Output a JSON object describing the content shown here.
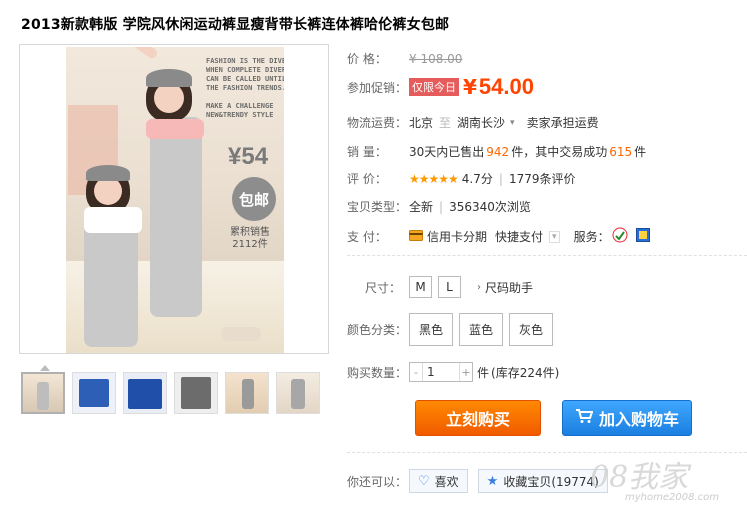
{
  "title": "2013新款韩版 学院风休闲运动裤显瘦背带长裤连体裤哈伦裤女包邮",
  "image_overlay": {
    "text": "FASHION IS THE DIVERSITY\nWHEN COMPLETE DIVERSITY\nCAN BE CALLED UNTIL\nTHE FASHION TRENDS.\n\nMAKE A CHALLENGE\nNEW&TRENDY STYLE",
    "price": "¥54",
    "badge": "包邮",
    "sold": "累积销售\n2112件"
  },
  "price": {
    "label": "价 格：",
    "original": "¥ 108.00"
  },
  "promo": {
    "label": "参加促销：",
    "tag": "仅限今日",
    "currency": "¥",
    "value": "54.00"
  },
  "shipping": {
    "label": "物流运费：",
    "from": "北京",
    "divider": "至",
    "to": "湖南长沙",
    "fee": "卖家承担运费"
  },
  "sales": {
    "label": "销 量：",
    "prefix": "30天内已售出",
    "count": "942",
    "mid": "件，其中交易成功",
    "success": "615",
    "suffix": "件"
  },
  "rating": {
    "label": "评 价：",
    "stars": "★★★★★",
    "score": "4.7分",
    "reviews": "1779条评价"
  },
  "item_type": {
    "label": "宝贝类型：",
    "condition": "全新",
    "views": "356340次浏览"
  },
  "payment": {
    "label": "支 付：",
    "credit": "信用卡分期",
    "fast": "快捷支付",
    "service_label": "服务："
  },
  "size": {
    "label": "尺寸：",
    "options": [
      "M",
      "L"
    ],
    "helper": "尺码助手"
  },
  "color": {
    "label": "颜色分类：",
    "options": [
      "黑色",
      "蓝色",
      "灰色"
    ]
  },
  "quantity": {
    "label": "购买数量：",
    "minus": "-",
    "value": "1",
    "plus": "+",
    "unit": "件",
    "stock": "(库存224件)"
  },
  "buttons": {
    "buy": "立刻购买",
    "cart": "加入购物车"
  },
  "actions": {
    "label": "你还可以：",
    "like": "喜欢",
    "favorite": "收藏宝贝(19774)"
  },
  "watermark": {
    "text": "08我家",
    "url": "myhome2008.com"
  },
  "colors": {
    "accent": "#ff4400",
    "buy": "#f05a00",
    "cart": "#1b7fe0"
  }
}
